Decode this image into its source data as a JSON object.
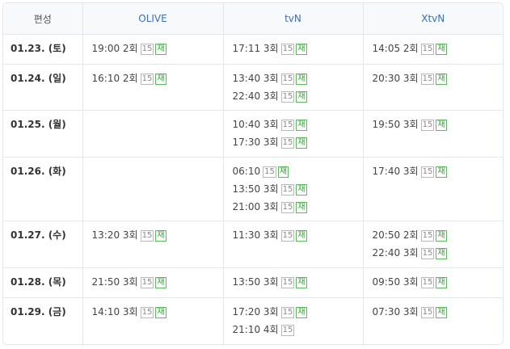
{
  "header": {
    "col0": "편성",
    "col1": "OLIVE",
    "col2": "tvN",
    "col3": "XtvN"
  },
  "badges": {
    "age": "15",
    "rerun": "재"
  },
  "rows": [
    {
      "date": "01.23. (토)",
      "olive": [
        {
          "t": "19:00 2회",
          "re": true
        }
      ],
      "tvn": [
        {
          "t": "17:11 3회",
          "re": true
        }
      ],
      "xtvn": [
        {
          "t": "14:05 2회",
          "re": true
        }
      ]
    },
    {
      "date": "01.24. (일)",
      "olive": [
        {
          "t": "16:10 2회",
          "re": true
        }
      ],
      "tvn": [
        {
          "t": "13:40 3회",
          "re": true
        },
        {
          "t": "22:40 3회",
          "re": true
        }
      ],
      "xtvn": [
        {
          "t": "20:30 3회",
          "re": true
        }
      ]
    },
    {
      "date": "01.25. (월)",
      "olive": [],
      "tvn": [
        {
          "t": "10:40 3회",
          "re": true
        },
        {
          "t": "17:30 3회",
          "re": true
        }
      ],
      "xtvn": [
        {
          "t": "19:50 3회",
          "re": true
        }
      ]
    },
    {
      "date": "01.26. (화)",
      "olive": [],
      "tvn": [
        {
          "t": "06:10",
          "re": true
        },
        {
          "t": "13:50 3회",
          "re": true
        },
        {
          "t": "21:00 3회",
          "re": true
        }
      ],
      "xtvn": [
        {
          "t": "17:40 3회",
          "re": true
        }
      ]
    },
    {
      "date": "01.27. (수)",
      "olive": [
        {
          "t": "13:20 3회",
          "re": true
        }
      ],
      "tvn": [
        {
          "t": "11:30 3회",
          "re": true
        }
      ],
      "xtvn": [
        {
          "t": "20:50 2회",
          "re": true
        },
        {
          "t": "22:40 3회",
          "re": true
        }
      ]
    },
    {
      "date": "01.28. (목)",
      "olive": [
        {
          "t": "21:50 3회",
          "re": true
        }
      ],
      "tvn": [
        {
          "t": "13:50 3회",
          "re": true
        }
      ],
      "xtvn": [
        {
          "t": "09:50 3회",
          "re": true
        }
      ]
    },
    {
      "date": "01.29. (금)",
      "olive": [
        {
          "t": "14:10 3회",
          "re": true
        }
      ],
      "tvn": [
        {
          "t": "17:20 3회",
          "re": true
        },
        {
          "t": "21:10 4회",
          "re": false
        }
      ],
      "xtvn": [
        {
          "t": "07:30 3회",
          "re": true
        }
      ]
    }
  ]
}
